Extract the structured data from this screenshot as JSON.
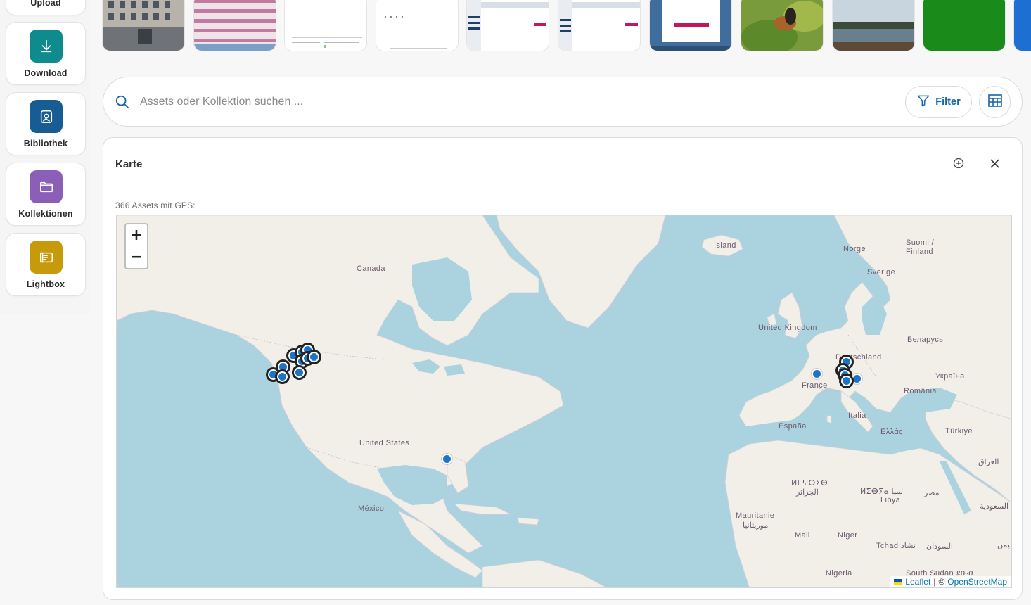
{
  "sidebar": {
    "items": [
      {
        "label": "Upload",
        "icon": "upload-icon",
        "color": "#0f8b8d"
      },
      {
        "label": "Download",
        "icon": "download-icon",
        "color": "#0f8b8d"
      },
      {
        "label": "Bibliothek",
        "icon": "image-library-icon",
        "color": "#175d93"
      },
      {
        "label": "Kollektionen",
        "icon": "folder-icon",
        "color": "#8b5fb8"
      },
      {
        "label": "Lightbox",
        "icon": "lightbox-icon",
        "color": "#c79a0c"
      }
    ]
  },
  "search": {
    "placeholder": "Assets oder Kollektion suchen ...",
    "filter_label": "Filter"
  },
  "map_panel": {
    "title": "Karte",
    "gps_count": "366 Assets mit GPS:",
    "zoom_in": "+",
    "zoom_out": "−",
    "attribution_leaflet": "Leaflet",
    "attribution_sep": "|",
    "attribution_copy": "©",
    "attribution_osm": "OpenStreetMap"
  },
  "map_labels": {
    "island": "Ísland",
    "norge": "Norge",
    "suomi": "Suomi /",
    "finland": "Finland",
    "sverige": "Sverige",
    "canada": "Canada",
    "uk": "United Kingdom",
    "belarus": "Беларусь",
    "deutschland": "Deutschland",
    "ukraina": "Україна",
    "france": "France",
    "romania": "România",
    "italia": "Italia",
    "espana": "España",
    "ellas": "Ελλάς",
    "turkiye": "Türkiye",
    "usa": "United States",
    "iraq": "العراق",
    "mexico": "México",
    "morocco": "ⵍⵎⵖⵔⵉⴱ",
    "algeria": "الجزائر",
    "libya_tz": "ⵍⵉⴱⵢⴰ ليبيا",
    "libya": "Libya",
    "egypt": "مصر",
    "saudi": "السعودية",
    "mauritanie": "Mauritanie",
    "mauritania_ar": "موريتانيا",
    "mali": "Mali",
    "niger": "Niger",
    "tchad": "Tchad تشاد",
    "sudan": "السودان",
    "yemen": "اليمن",
    "nigeria": "Nigeria",
    "south_sudan": "South Sudan ደቡብ"
  },
  "colors": {
    "accent": "#1565a8",
    "marker": "#1c74c8",
    "water": "#aad3df",
    "land": "#f2efe9"
  }
}
